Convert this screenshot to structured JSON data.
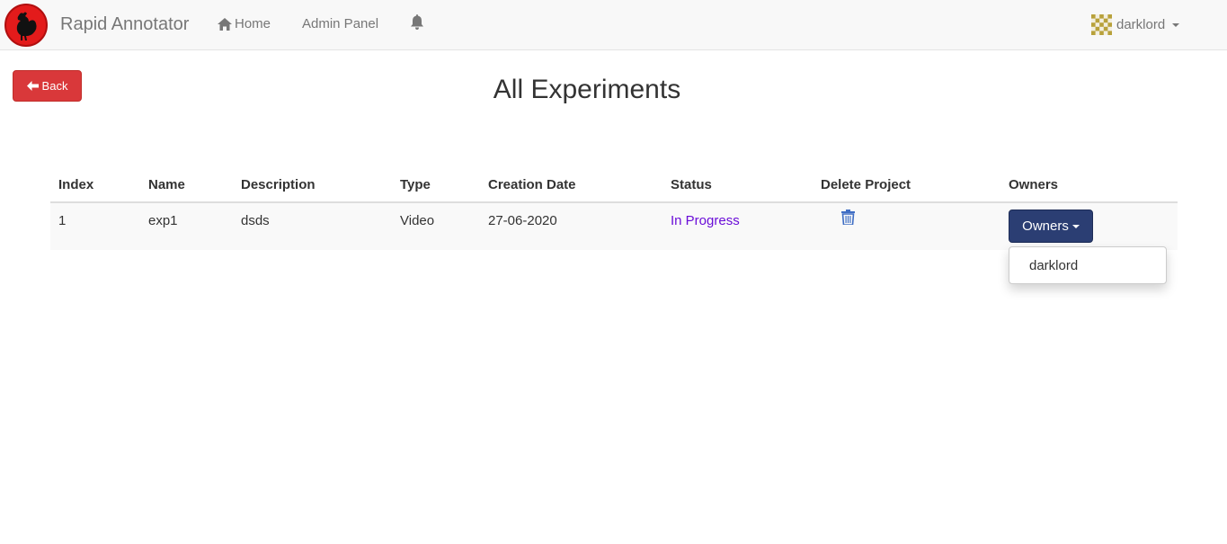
{
  "navbar": {
    "brand": "Rapid Annotator",
    "home_label": "Home",
    "admin_label": "Admin Panel",
    "username": "darklord"
  },
  "back_button": {
    "label": "Back"
  },
  "page": {
    "title": "All Experiments"
  },
  "table": {
    "headers": [
      "Index",
      "Name",
      "Description",
      "Type",
      "Creation Date",
      "Status",
      "Delete Project",
      "Owners"
    ],
    "rows": [
      {
        "index": "1",
        "name": "exp1",
        "description": "dsds",
        "type": "Video",
        "creation_date": "27-06-2020",
        "status": "In Progress",
        "owners_button": "Owners"
      }
    ]
  },
  "owners_dropdown": {
    "items": [
      "darklord"
    ]
  },
  "colors": {
    "danger": "#d9383a",
    "primary": "#2b3e73",
    "status": "#6a0dd8",
    "trash": "#3f6ec4"
  },
  "icons": {
    "logo": "rooster-logo",
    "home": "home-icon",
    "bell": "bell-icon",
    "back": "arrow-left-icon",
    "delete": "trash-icon"
  }
}
